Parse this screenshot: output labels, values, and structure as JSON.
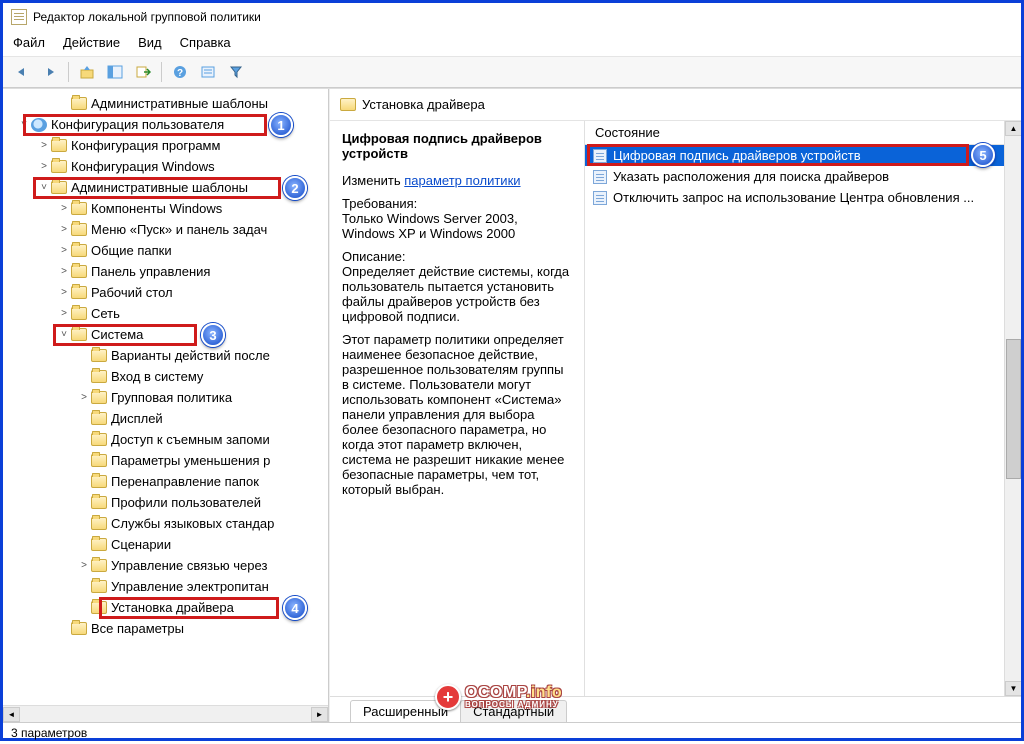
{
  "window": {
    "title": "Редактор локальной групповой политики"
  },
  "menu": {
    "file": "Файл",
    "action": "Действие",
    "view": "Вид",
    "help": "Справка"
  },
  "tree": [
    {
      "indent": 2,
      "icon": "fld",
      "caret": "",
      "label": "Административные шаблоны"
    },
    {
      "indent": 0,
      "icon": "usr",
      "caret": "˅",
      "label": "Конфигурация пользователя"
    },
    {
      "indent": 1,
      "icon": "fld",
      "caret": ">",
      "label": "Конфигурация программ"
    },
    {
      "indent": 1,
      "icon": "fld",
      "caret": ">",
      "label": "Конфигурация Windows"
    },
    {
      "indent": 1,
      "icon": "fld",
      "caret": "˅",
      "label": "Административные шаблоны"
    },
    {
      "indent": 2,
      "icon": "fld",
      "caret": ">",
      "label": "Компоненты Windows"
    },
    {
      "indent": 2,
      "icon": "fld",
      "caret": ">",
      "label": "Меню «Пуск» и панель задач"
    },
    {
      "indent": 2,
      "icon": "fld",
      "caret": ">",
      "label": "Общие папки"
    },
    {
      "indent": 2,
      "icon": "fld",
      "caret": ">",
      "label": "Панель управления"
    },
    {
      "indent": 2,
      "icon": "fld",
      "caret": ">",
      "label": "Рабочий стол"
    },
    {
      "indent": 2,
      "icon": "fld",
      "caret": ">",
      "label": "Сеть"
    },
    {
      "indent": 2,
      "icon": "fld",
      "caret": "˅",
      "label": "Система"
    },
    {
      "indent": 3,
      "icon": "fld",
      "caret": "",
      "label": "Варианты действий после"
    },
    {
      "indent": 3,
      "icon": "fld",
      "caret": "",
      "label": "Вход в систему"
    },
    {
      "indent": 3,
      "icon": "fld",
      "caret": ">",
      "label": "Групповая политика"
    },
    {
      "indent": 3,
      "icon": "fld",
      "caret": "",
      "label": "Дисплей"
    },
    {
      "indent": 3,
      "icon": "fld",
      "caret": "",
      "label": "Доступ к съемным запоми"
    },
    {
      "indent": 3,
      "icon": "fld",
      "caret": "",
      "label": "Параметры уменьшения р"
    },
    {
      "indent": 3,
      "icon": "fld",
      "caret": "",
      "label": "Перенаправление папок"
    },
    {
      "indent": 3,
      "icon": "fld",
      "caret": "",
      "label": "Профили пользователей"
    },
    {
      "indent": 3,
      "icon": "fld",
      "caret": "",
      "label": "Службы языковых стандар"
    },
    {
      "indent": 3,
      "icon": "fld",
      "caret": "",
      "label": "Сценарии"
    },
    {
      "indent": 3,
      "icon": "fld",
      "caret": ">",
      "label": "Управление связью через"
    },
    {
      "indent": 3,
      "icon": "fld",
      "caret": "",
      "label": "Управление электропитан"
    },
    {
      "indent": 3,
      "icon": "fld",
      "caret": "",
      "label": "Установка драйвера"
    },
    {
      "indent": 2,
      "icon": "fld",
      "caret": "",
      "label": "Все параметры"
    }
  ],
  "detail": {
    "header": "Установка драйвера",
    "title": "Цифровая подпись драйверов устройств",
    "edit_prefix": "Изменить",
    "edit_link": "параметр политики",
    "req_label": "Требования:",
    "req_text": "Только Windows Server 2003, Windows XP и Windows 2000",
    "desc_label": "Описание:",
    "desc1": "Определяет действие системы, когда пользователь пытается установить файлы драйверов устройств без цифровой подписи.",
    "desc2": "Этот параметр политики определяет наименее безопасное действие, разрешенное пользователям группы в системе. Пользователи могут использовать компонент «Система» панели управления для выбора более безопасного параметра, но когда этот параметр включен, система не разрешит никакие менее безопасные параметры, чем тот, который выбран.",
    "col_state": "Состояние",
    "settings": [
      {
        "label": "Цифровая подпись драйверов устройств",
        "selected": true
      },
      {
        "label": "Указать расположения для поиска драйверов",
        "selected": false
      },
      {
        "label": "Отключить запрос на использование Центра обновления ...",
        "selected": false
      }
    ],
    "tab_extended": "Расширенный",
    "tab_standard": "Стандартный"
  },
  "status": "3 параметров",
  "callouts": {
    "1": "1",
    "2": "2",
    "3": "3",
    "4": "4",
    "5": "5"
  },
  "watermark": {
    "main": "OCOMP",
    "suffix": ".info",
    "sub": "ВОПРОСЫ АДМИНУ",
    "badge": "+"
  }
}
